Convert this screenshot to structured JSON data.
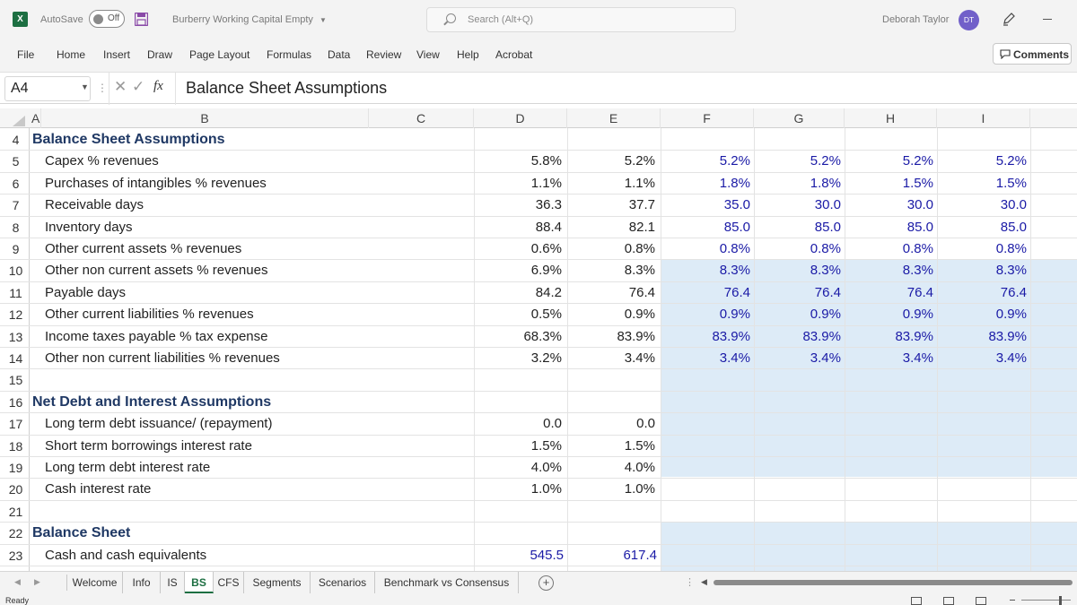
{
  "titlebar": {
    "app_icon": "X",
    "autosave_label": "AutoSave",
    "autosave_state": "Off",
    "file_name": "Burberry Working Capital Empty",
    "search_placeholder": "Search (Alt+Q)",
    "user_name": "Deborah Taylor",
    "user_initials": "DT"
  },
  "ribbon": {
    "tabs": [
      "File",
      "Home",
      "Insert",
      "Draw",
      "Page Layout",
      "Formulas",
      "Data",
      "Review",
      "View",
      "Help",
      "Acrobat"
    ],
    "comments_label": "Comments"
  },
  "formula_bar": {
    "name_box": "A4",
    "fx": "fx",
    "content": "Balance Sheet Assumptions"
  },
  "columns": [
    "A",
    "B",
    "C",
    "D",
    "E",
    "F",
    "G",
    "H",
    "I"
  ],
  "rows": [
    {
      "num": "4",
      "type": "header",
      "label": "Balance Sheet Assumptions",
      "values": [
        "",
        "",
        "",
        "",
        "",
        ""
      ]
    },
    {
      "num": "5",
      "type": "item",
      "label": "Capex % revenues",
      "values": [
        "5.8%",
        "5.2%",
        "5.2%",
        "5.2%",
        "5.2%",
        "5.2%"
      ]
    },
    {
      "num": "6",
      "type": "item",
      "label": "Purchases of intangibles % revenues",
      "values": [
        "1.1%",
        "1.1%",
        "1.8%",
        "1.8%",
        "1.5%",
        "1.5%"
      ]
    },
    {
      "num": "7",
      "type": "item",
      "label": "Receivable days",
      "values": [
        "36.3",
        "37.7",
        "35.0",
        "30.0",
        "30.0",
        "30.0"
      ]
    },
    {
      "num": "8",
      "type": "item",
      "label": "Inventory days",
      "values": [
        "88.4",
        "82.1",
        "85.0",
        "85.0",
        "85.0",
        "85.0"
      ]
    },
    {
      "num": "9",
      "type": "item",
      "label": "Other current assets % revenues",
      "values": [
        "0.6%",
        "0.8%",
        "0.8%",
        "0.8%",
        "0.8%",
        "0.8%"
      ]
    },
    {
      "num": "10",
      "type": "item",
      "label": "Other non current assets % revenues",
      "values": [
        "6.9%",
        "8.3%",
        "8.3%",
        "8.3%",
        "8.3%",
        "8.3%"
      ]
    },
    {
      "num": "11",
      "type": "item",
      "label": "Payable days",
      "values": [
        "84.2",
        "76.4",
        "76.4",
        "76.4",
        "76.4",
        "76.4"
      ]
    },
    {
      "num": "12",
      "type": "item",
      "label": "Other current liabilities % revenues",
      "values": [
        "0.5%",
        "0.9%",
        "0.9%",
        "0.9%",
        "0.9%",
        "0.9%"
      ]
    },
    {
      "num": "13",
      "type": "item",
      "label": "Income taxes payable % tax expense",
      "values": [
        "68.3%",
        "83.9%",
        "83.9%",
        "83.9%",
        "83.9%",
        "83.9%"
      ]
    },
    {
      "num": "14",
      "type": "item",
      "label": "Other non current liabilities % revenues",
      "values": [
        "3.2%",
        "3.4%",
        "3.4%",
        "3.4%",
        "3.4%",
        "3.4%"
      ]
    },
    {
      "num": "15",
      "type": "blank",
      "label": "",
      "values": [
        "",
        "",
        "",
        "",
        "",
        ""
      ]
    },
    {
      "num": "16",
      "type": "header",
      "label": "Net Debt and Interest Assumptions",
      "values": [
        "",
        "",
        "",
        "",
        "",
        ""
      ]
    },
    {
      "num": "17",
      "type": "item",
      "label": "Long term debt issuance/ (repayment)",
      "values": [
        "0.0",
        "0.0",
        "",
        "",
        "",
        ""
      ]
    },
    {
      "num": "18",
      "type": "item",
      "label": "Short term borrowings interest rate",
      "values": [
        "1.5%",
        "1.5%",
        "",
        "",
        "",
        ""
      ]
    },
    {
      "num": "19",
      "type": "item",
      "label": "Long term debt interest rate",
      "values": [
        "4.0%",
        "4.0%",
        "",
        "",
        "",
        ""
      ]
    },
    {
      "num": "20",
      "type": "item",
      "label": "Cash interest rate",
      "values": [
        "1.0%",
        "1.0%",
        "",
        "",
        "",
        ""
      ]
    },
    {
      "num": "21",
      "type": "blank",
      "label": "",
      "values": [
        "",
        "",
        "",
        "",
        "",
        ""
      ]
    },
    {
      "num": "22",
      "type": "header",
      "label": "Balance Sheet",
      "values": [
        "",
        "",
        "",
        "",
        "",
        ""
      ]
    },
    {
      "num": "23",
      "type": "item",
      "label": "Cash and cash equivalents",
      "values": [
        "545.5",
        "617.4",
        "",
        "",
        "",
        ""
      ]
    }
  ],
  "sheet_tabs": [
    "Welcome",
    "Info",
    "IS",
    "BS",
    "CFS",
    "Segments",
    "Scenarios",
    "Benchmark vs Consensus"
  ],
  "active_tab": "BS",
  "status": "Ready",
  "colors": {
    "shade": "#ddebf7",
    "forecast_text": "#1a1aa6",
    "header_text": "#1f3864",
    "active_tab": "#1d6f42"
  }
}
